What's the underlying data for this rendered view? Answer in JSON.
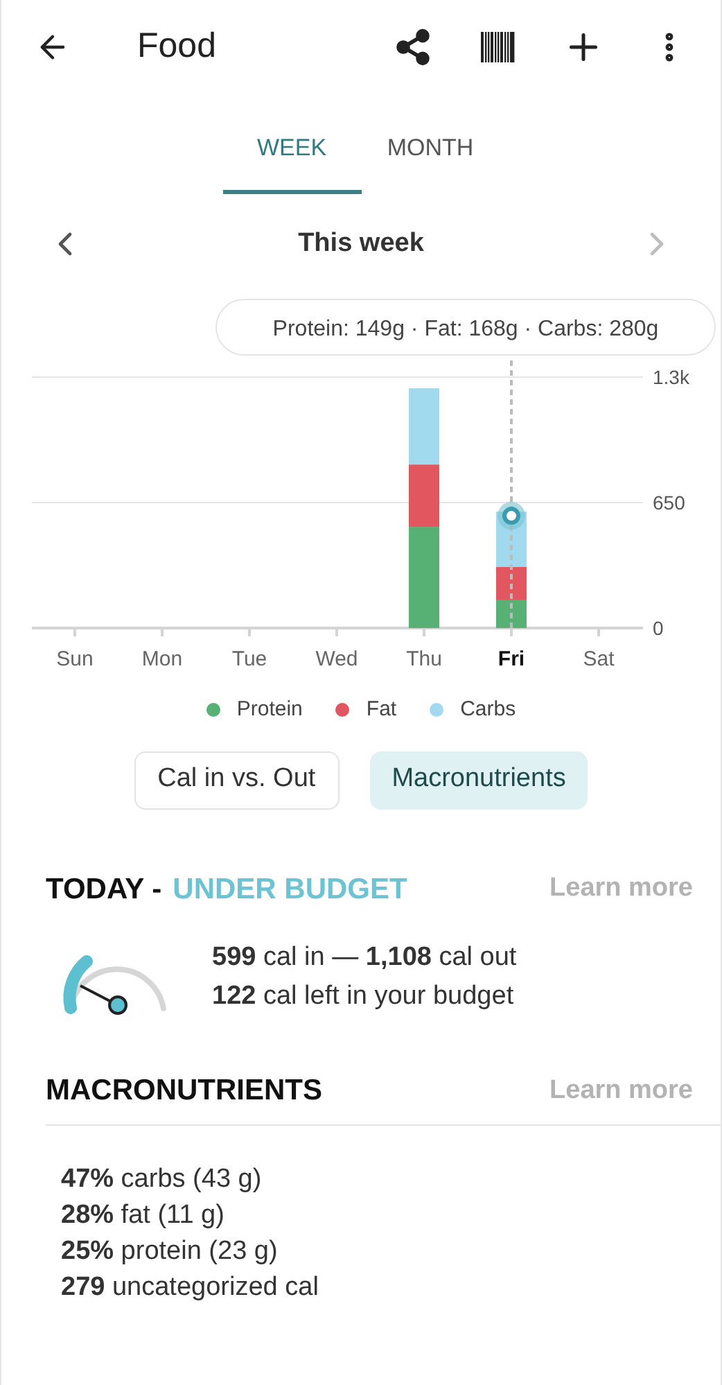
{
  "header": {
    "title": "Food"
  },
  "tabs": [
    {
      "label": "WEEK",
      "selected": true
    },
    {
      "label": "MONTH",
      "selected": false
    }
  ],
  "period": {
    "label": "This week",
    "next_disabled": true
  },
  "chart": {
    "chart_data": {
      "type": "bar",
      "stacked": true,
      "categories": [
        "Sun",
        "Mon",
        "Tue",
        "Wed",
        "Thu",
        "Fri",
        "Sat"
      ],
      "series": [
        {
          "name": "Protein",
          "color": "#57b074",
          "values": [
            null,
            null,
            null,
            null,
            524,
            144,
            null
          ]
        },
        {
          "name": "Fat",
          "color": "#e2565f",
          "values": [
            null,
            null,
            null,
            null,
            323,
            172,
            null
          ]
        },
        {
          "name": "Carbs",
          "color": "#a1d9ef",
          "values": [
            null,
            null,
            null,
            null,
            395,
            287,
            null
          ]
        }
      ],
      "ylim": [
        0,
        1300
      ],
      "yticks": [
        0,
        650,
        {
          "value": 1300,
          "label": "1.3k"
        }
      ],
      "annotations": [
        "Protein: 149g · Fat: 168g · Carbs: 280g"
      ]
    },
    "selected_days": [
      false,
      false,
      false,
      false,
      false,
      true,
      false
    ]
  },
  "chart_toggles": [
    {
      "label": "Cal in vs. Out",
      "selected": false
    },
    {
      "label": "Macronutrients",
      "selected": true
    }
  ],
  "today": {
    "heading": "TODAY -",
    "status": "UNDER BUDGET",
    "link": "Learn more",
    "lines": [
      "**599** cal in — **1,108** cal out",
      "**122** cal left in your budget"
    ]
  },
  "macronutrients": {
    "heading": "MACRONUTRIENTS",
    "link": "Learn more",
    "lines": [
      "**47%** carbs (43 g)",
      "**28%** fat (11 g)",
      "**25%** protein (23 g)",
      "**279** uncategorized cal"
    ]
  }
}
